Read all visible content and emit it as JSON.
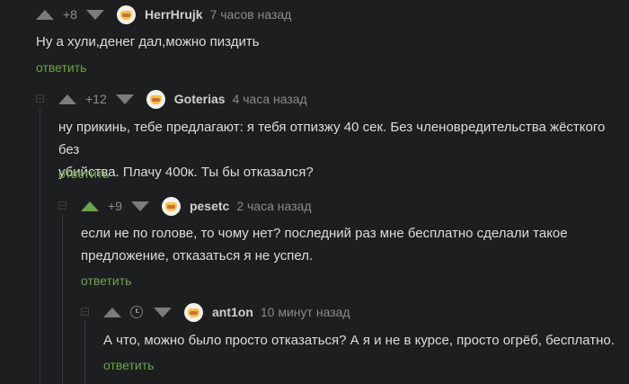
{
  "colors": {
    "background": "#1d1e20",
    "accent": "#6ea34a",
    "text": "#dcdcdc",
    "muted": "#8a8a8a"
  },
  "comments": [
    {
      "rating": "+8",
      "author": "HerrHrujk",
      "time": "7 часов назад",
      "lines": [
        "Ну а хули,денег дал,можно пиздить"
      ],
      "reply_label": "ответить"
    },
    {
      "rating": "+12",
      "author": "Goterias",
      "time": "4 часа назад",
      "lines": [
        "ну прикинь, тебе предлагают: я тебя отпизжу 40 сек. Без членовредительства жёсткого без",
        "убийства. Плачу 400к. Ты бы отказался?"
      ],
      "reply_label": "ответить"
    },
    {
      "rating": "+9",
      "author": "pesetc",
      "time": "2 часа назад",
      "upvoted": true,
      "lines": [
        "если не по голове, то чому нет? последний раз мне бесплатно сделали такое",
        "предложение, отказаться я не успел."
      ],
      "reply_label": "ответить"
    },
    {
      "rating_hidden": true,
      "rating_icon": "clock-icon",
      "author": "ant1on",
      "time": "10 минут назад",
      "lines": [
        "А что, можно было просто отказаться? А я и не в курсе, просто огрёб, бесплатно."
      ],
      "reply_label": "ответить"
    }
  ]
}
